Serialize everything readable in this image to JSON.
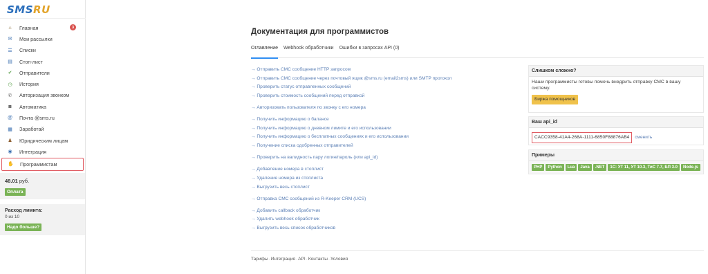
{
  "logo": {
    "main": "SMS",
    "accent": "RU"
  },
  "sidebar": {
    "items": [
      {
        "label": "Главная",
        "icon": "home-icon",
        "icon_color": "#8a6d3b",
        "badge": "3"
      },
      {
        "label": "Мои рассылки",
        "icon": "mailings-icon",
        "icon_color": "#3a6fb0"
      },
      {
        "label": "Списки",
        "icon": "lists-icon",
        "icon_color": "#4a79b8"
      },
      {
        "label": "Стоп-лист",
        "icon": "stop-list-icon",
        "icon_color": "#3a6fb0"
      },
      {
        "label": "Отправители",
        "icon": "senders-icon",
        "icon_color": "#5aa04a"
      },
      {
        "label": "История",
        "icon": "history-icon",
        "icon_color": "#5aa04a"
      },
      {
        "label": "Авторизация звонком",
        "icon": "phone-icon",
        "icon_color": "#777777"
      },
      {
        "label": "Автоматика",
        "icon": "robot-icon",
        "icon_color": "#555555"
      },
      {
        "label": "Почта @sms.ru",
        "icon": "at-icon",
        "icon_color": "#3a6fb0"
      },
      {
        "label": "Заработай",
        "icon": "earn-icon",
        "icon_color": "#3a6fb0"
      },
      {
        "label": "Юридическим лицам",
        "icon": "person-icon",
        "icon_color": "#8a5a2b"
      },
      {
        "label": "Интеграция",
        "icon": "integration-icon",
        "icon_color": "#3a6fb0"
      },
      {
        "label": "Программистам",
        "icon": "developer-icon",
        "icon_color": "#d9a54a",
        "active": true
      }
    ],
    "balance": {
      "amount": "48.01",
      "currency": "руб.",
      "pay_label": "Оплата"
    },
    "limit": {
      "title": "Расход лимита:",
      "value": "0 из 10",
      "more_label": "Надо больше?"
    }
  },
  "main": {
    "title": "Документация для программистов",
    "tabs": [
      {
        "label": "Оглавление",
        "active": true
      },
      {
        "label": "Webhook обработчики"
      },
      {
        "label": "Ошибки в запросах API (0)"
      }
    ],
    "link_groups": [
      [
        "→ Отправить СМС сообщение HTTP запросом",
        "→ Отправить СМС сообщение через почтовый ящик @sms.ru (email2sms) или SMTP протокол",
        "→ Проверить статус отправленных сообщений",
        "→ Проверить стоимость сообщений перед отправкой"
      ],
      [
        "→ Авторизовать пользователя по звонку с его номера"
      ],
      [
        "→ Получить информацию о балансе",
        "→ Получить информацию о дневном лимите и его использовании",
        "→ Получить информацию о бесплатных сообщениях и его использовании",
        "→ Получение списка одобренных отправителей"
      ],
      [
        "→ Проверить на валидность пару логин/пароль (или api_id)"
      ],
      [
        "→ Добавление номера в стоплист",
        "→ Удаление номера из стоплиста",
        "→ Выгрузить весь стоплист"
      ],
      [
        "→ Отправка СМС сообщений из R-Keeper CRM (UCS)"
      ],
      [
        "→ Добавить callback обработчик",
        "→ Удалить webhook обработчик",
        "→ Выгрузить весь список обработчиков"
      ]
    ],
    "footer": [
      "Тарифы",
      "Интеграция",
      "API",
      "Контакты",
      "Условия"
    ]
  },
  "panels": {
    "help": {
      "title": "Слишком сложно?",
      "text": "Наши программисты готовы помочь внедрить отправку СМС в вашу систему.",
      "button": "Биржа помощников"
    },
    "api": {
      "title": "Ваш api_id",
      "key": "CACC9358-41A4-268A-1111-6850F88876AB4",
      "change_label": "сменить"
    },
    "examples": {
      "title": "Примеры",
      "items": [
        "PHP",
        "Python",
        "Lua",
        "Java",
        ".NET",
        "1С: УТ 11, УТ 10.3, ТиС 7.7, БП 3.0",
        "Node.js"
      ]
    }
  },
  "colors": {
    "accent_blue": "#2f8ef3",
    "link": "#5b7fb5",
    "green": "#7ab356",
    "yellow": "#f0c24b",
    "highlight_red": "#e05b62"
  }
}
